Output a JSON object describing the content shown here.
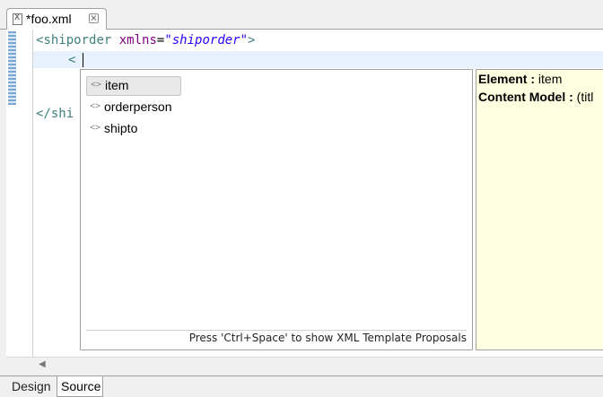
{
  "tab": {
    "title": "*foo.xml",
    "file_icon": "xml-file-icon",
    "close_icon": "close-icon"
  },
  "code": {
    "line1": {
      "open": "<",
      "tag": "shiporder",
      "attr_name": "xmlns",
      "equals": "=",
      "attr_value": "\"shiporder\"",
      "close": ">"
    },
    "line2": {
      "text": "<"
    },
    "line5": {
      "text": "</shi"
    }
  },
  "proposals": {
    "items": [
      {
        "label": "item",
        "icon": "xml-element-icon",
        "selected": true
      },
      {
        "label": "orderperson",
        "icon": "xml-element-icon",
        "selected": false
      },
      {
        "label": "shipto",
        "icon": "xml-element-icon",
        "selected": false
      }
    ],
    "icon_glyph": "<>",
    "status_hint": "Press 'Ctrl+Space' to show XML Template Proposals"
  },
  "info": {
    "element_label": "Element :",
    "element_value": " item",
    "content_model_label": "Content Model :",
    "content_model_value": " (titl"
  },
  "bottom_tabs": {
    "design": "Design",
    "source": "Source"
  },
  "colors": {
    "tag": "#3f7f7f",
    "attr": "#7f007f",
    "attr_value": "#2a00ff",
    "info_bg": "#ffffe1",
    "current_line": "#e8f2fe"
  }
}
